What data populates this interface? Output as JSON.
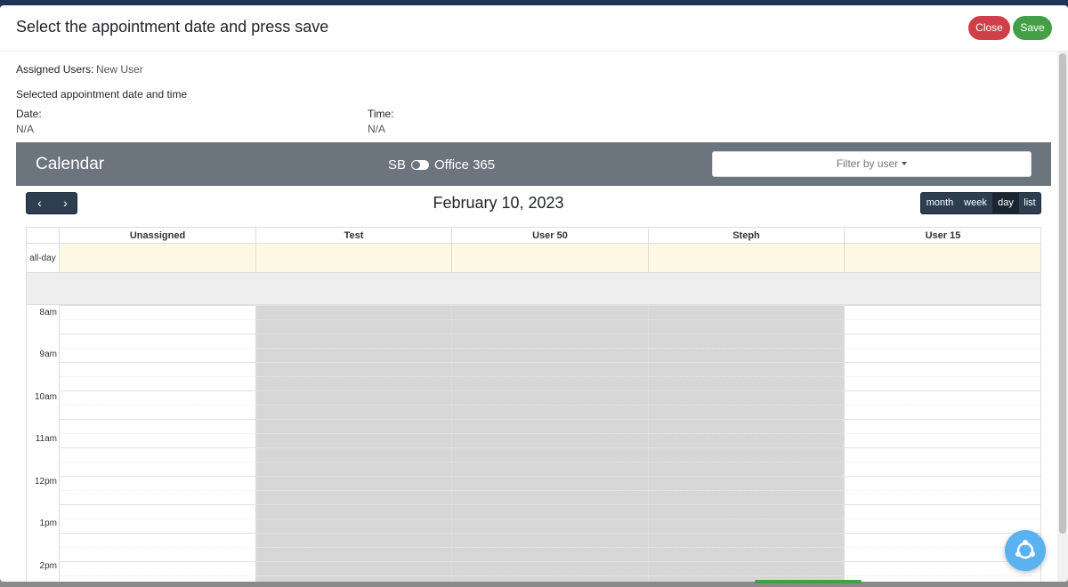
{
  "modal": {
    "title": "Select the appointment date and press save",
    "close_label": "Close",
    "save_label": "Save"
  },
  "assigned": {
    "label": "Assigned Users:",
    "value": "New User"
  },
  "selected": {
    "heading": "Selected appointment date and time",
    "date_label": "Date:",
    "date_value": "N/A",
    "time_label": "Time:",
    "time_value": "N/A"
  },
  "calendar": {
    "title": "Calendar",
    "toggle_left": "SB",
    "toggle_right": "Office 365",
    "filter_label": "Filter by user",
    "prev_icon": "‹",
    "next_icon": "›",
    "current_date": "February 10, 2023",
    "views": [
      "month",
      "week",
      "day",
      "list"
    ],
    "active_view": "day",
    "allday_label": "all-day",
    "columns": [
      "Unassigned",
      "Test",
      "User 50",
      "Steph",
      "User 15"
    ],
    "times": [
      "8am",
      "9am",
      "10am",
      "11am",
      "12pm",
      "1pm",
      "2pm"
    ]
  },
  "colors": {
    "header_bg": "#6c757d",
    "close_btn": "#cf3f47",
    "save_btn": "#43a047",
    "nav_btn": "#2c3e50",
    "allday_bg": "#fcf8e3",
    "busy_bg": "#d7d7d7",
    "fab_bg": "#5ab3f0"
  }
}
